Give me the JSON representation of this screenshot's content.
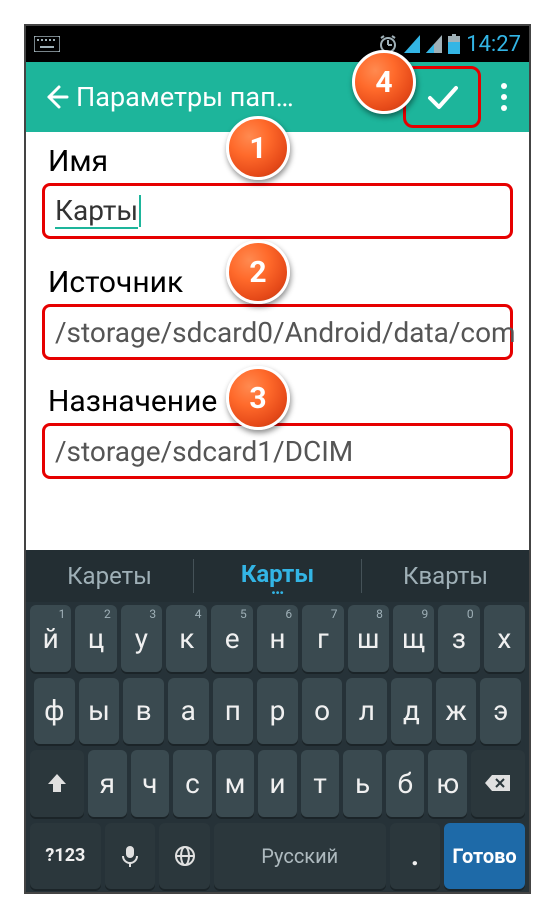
{
  "status": {
    "time": "14:27"
  },
  "toolbar": {
    "title": "Параметры пап…"
  },
  "form": {
    "name_label": "Имя",
    "name_value": "Карты",
    "source_label": "Источник",
    "source_value": "/storage/sdcard0/Android/data/com",
    "dest_label": "Назначение",
    "dest_value": "/storage/sdcard1/DCIM"
  },
  "badges": {
    "b1": "1",
    "b2": "2",
    "b3": "3",
    "b4": "4"
  },
  "keyboard": {
    "suggestions": {
      "left": "Кареты",
      "mid": "Карты",
      "right": "Кварты"
    },
    "row1": [
      {
        "l": "й",
        "h": "1"
      },
      {
        "l": "ц",
        "h": "2"
      },
      {
        "l": "у",
        "h": "3"
      },
      {
        "l": "к",
        "h": "4"
      },
      {
        "l": "е",
        "h": "5"
      },
      {
        "l": "н",
        "h": "6"
      },
      {
        "l": "г",
        "h": "7"
      },
      {
        "l": "ш",
        "h": "8"
      },
      {
        "l": "щ",
        "h": "9"
      },
      {
        "l": "з",
        "h": "0"
      },
      {
        "l": "х",
        "h": ""
      }
    ],
    "row2": [
      {
        "l": "ф"
      },
      {
        "l": "ы"
      },
      {
        "l": "в"
      },
      {
        "l": "а"
      },
      {
        "l": "п"
      },
      {
        "l": "р"
      },
      {
        "l": "о"
      },
      {
        "l": "л"
      },
      {
        "l": "д"
      },
      {
        "l": "ж"
      },
      {
        "l": "э"
      }
    ],
    "row3": [
      {
        "l": "я"
      },
      {
        "l": "ч"
      },
      {
        "l": "с"
      },
      {
        "l": "м"
      },
      {
        "l": "и"
      },
      {
        "l": "т"
      },
      {
        "l": "ь"
      },
      {
        "l": "б"
      },
      {
        "l": "ю"
      }
    ],
    "bottom": {
      "sym": "?123",
      "lang": "Русский",
      "dot": ".",
      "done": "Готово"
    }
  }
}
